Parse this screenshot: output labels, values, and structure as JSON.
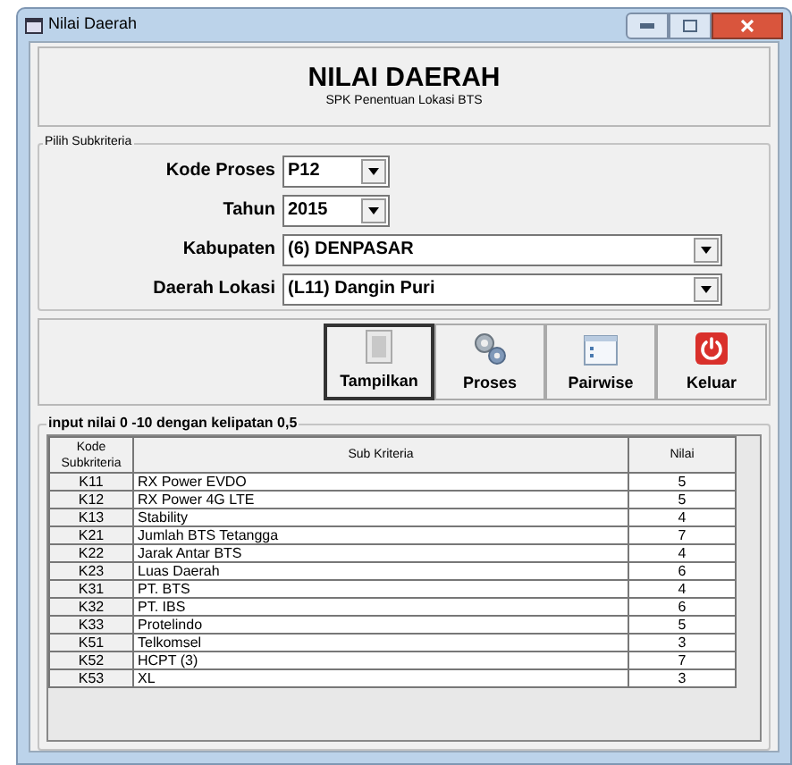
{
  "window": {
    "title": "Nilai Daerah"
  },
  "header": {
    "title": "NILAI DAERAH",
    "subtitle": "SPK Penentuan Lokasi BTS"
  },
  "filter_group": {
    "legend": "Pilih Subkriteria",
    "fields": [
      {
        "label": "Kode Proses",
        "value": "P12",
        "kind": "short"
      },
      {
        "label": "Tahun",
        "value": "2015",
        "kind": "short"
      },
      {
        "label": "Kabupaten",
        "value": "(6) DENPASAR",
        "kind": "long"
      },
      {
        "label": "Daerah Lokasi",
        "value": "(L11) Dangin Puri",
        "kind": "long"
      }
    ]
  },
  "buttons": [
    {
      "label": "Tampilkan",
      "kind": "document",
      "selected": true
    },
    {
      "label": "Proses",
      "kind": "gears",
      "selected": false
    },
    {
      "label": "Pairwise",
      "kind": "list",
      "selected": false
    },
    {
      "label": "Keluar",
      "kind": "power",
      "selected": false
    }
  ],
  "table_group": {
    "legend": "input nilai 0 -10 dengan kelipatan 0,5",
    "columns": [
      "Kode Subkriteria",
      "Sub Kriteria",
      "Nilai"
    ],
    "rows": [
      [
        "K11",
        "RX Power EVDO",
        "5"
      ],
      [
        "K12",
        "RX Power 4G LTE",
        "5"
      ],
      [
        "K13",
        "Stability",
        "4"
      ],
      [
        "K21",
        "Jumlah BTS Tetangga",
        "7"
      ],
      [
        "K22",
        "Jarak Antar BTS",
        "4"
      ],
      [
        "K23",
        "Luas Daerah",
        "6"
      ],
      [
        "K31",
        "PT. BTS",
        "4"
      ],
      [
        "K32",
        "PT. IBS",
        "6"
      ],
      [
        "K33",
        "Protelindo",
        "5"
      ],
      [
        "K51",
        "Telkomsel",
        "3"
      ],
      [
        "K52",
        "HCPT (3)",
        "7"
      ],
      [
        "K53",
        "XL",
        "3"
      ]
    ]
  }
}
